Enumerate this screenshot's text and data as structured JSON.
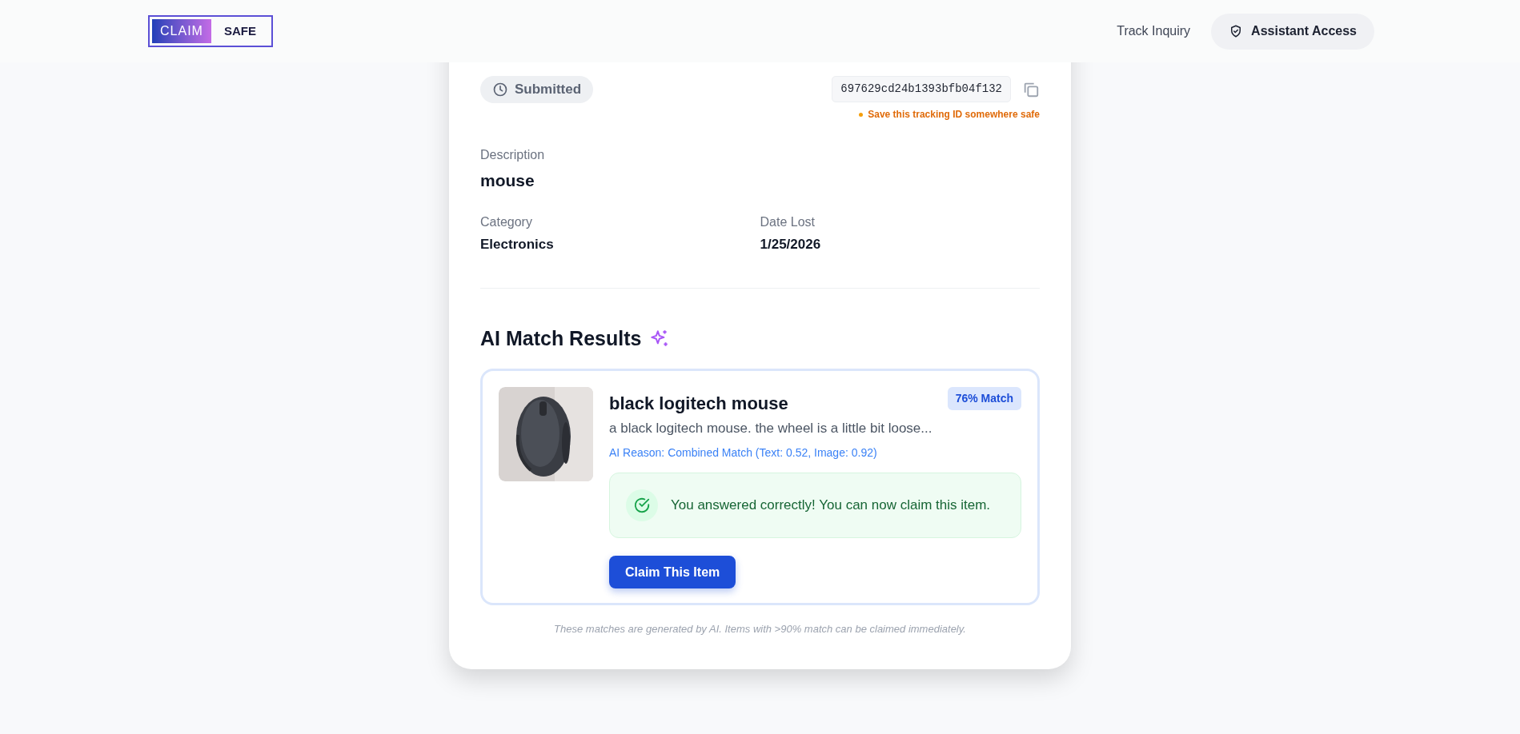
{
  "header": {
    "logo": {
      "left": "CLAIM",
      "right": "SAFE"
    },
    "nav": [
      {
        "kind": "link",
        "label": "Track Inquiry"
      },
      {
        "kind": "button",
        "label": "Assistant Access"
      }
    ]
  },
  "inquiry": {
    "status": "Submitted",
    "id": "697629cd24b1393bfb04f132",
    "id_note": "Save this tracking ID somewhere safe",
    "fields": [
      {
        "kind": "wide",
        "label": "Description",
        "value": "mouse"
      },
      {
        "kind": "half",
        "label": "Category",
        "value": "Electronics"
      },
      {
        "kind": "half",
        "label": "Date Lost",
        "value": "1/25/2026"
      }
    ]
  },
  "matches": {
    "title": "AI Match Results",
    "items": [
      {
        "title": "black logitech mouse",
        "badge": "76% Match",
        "description": "a black logitech mouse. the wheel is a little bit loose...",
        "reason": "AI Reason: Combined Match (Text: 0.52, Image: 0.92)",
        "notice": "You answered correctly! You can now claim this item.",
        "button": "Claim This Item"
      }
    ],
    "footnote": "These matches are generated by AI. Items with >90% match can be claimed immediately."
  }
}
